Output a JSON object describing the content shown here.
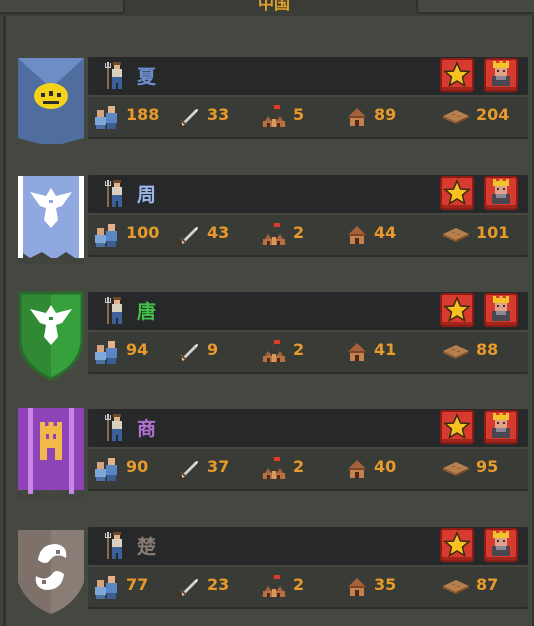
{
  "header": {
    "title": "中国"
  },
  "factions": [
    {
      "name": "夏",
      "name_color": "#6e8fd0",
      "banner": "blue-pennant-emblem",
      "population": "188",
      "warriors": "33",
      "cities": "5",
      "villages": "89",
      "land": "204"
    },
    {
      "name": "周",
      "name_color": "#9db6ec",
      "banner": "light-blue-eagle-flag",
      "population": "100",
      "warriors": "43",
      "cities": "2",
      "villages": "44",
      "land": "101"
    },
    {
      "name": "唐",
      "name_color": "#44c049",
      "banner": "green-eagle-shield",
      "population": "94",
      "warriors": "9",
      "cities": "2",
      "villages": "41",
      "land": "88"
    },
    {
      "name": "商",
      "name_color": "#b370d4",
      "banner": "purple-tower-banner",
      "population": "90",
      "warriors": "37",
      "cities": "2",
      "villages": "40",
      "land": "95"
    },
    {
      "name": "楚",
      "name_color": "#8a7c72",
      "banner": "brown-yin-yang-shield",
      "population": "77",
      "warriors": "23",
      "cities": "2",
      "villages": "35",
      "land": "87"
    }
  ],
  "icons": {
    "leader": "farmer-with-pitchfork-icon",
    "population": "people-icon",
    "warriors": "sword-icon",
    "cities": "city-icon",
    "villages": "house-icon",
    "land": "land-tile-icon",
    "favorite": "star-icon",
    "king": "king-crown-icon"
  },
  "colors": {
    "accent": "#e89a2a",
    "button_red": "#d73a2e"
  }
}
